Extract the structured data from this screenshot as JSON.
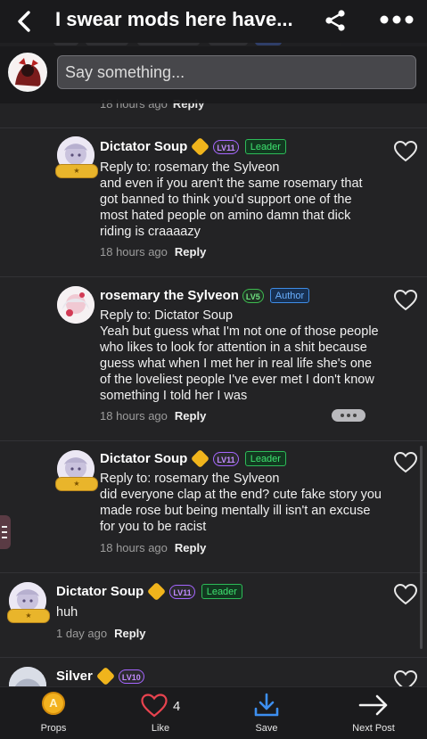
{
  "header": {
    "title": "I swear mods here have...",
    "back_icon": "chevron-left-icon",
    "share_icon": "share-icon",
    "more_icon": "more-horizontal-icon"
  },
  "composer": {
    "placeholder": "Say something..."
  },
  "previous_comment_meta": {
    "time": "18 hours ago",
    "reply": "Reply"
  },
  "comments": [
    {
      "username": "Dictator Soup",
      "level": "LV11",
      "tag": "Leader",
      "reply_to": "Reply to: rosemary the Sylveon",
      "text": "and even if you aren't the same rosemary that got banned to think you'd support one of the most hated people on amino damn that dick riding is craaaazy",
      "time": "18 hours ago",
      "reply": "Reply"
    },
    {
      "username": "rosemary the Sylveon",
      "level": "LV5",
      "tag": "Author",
      "reply_to": "Reply to: Dictator Soup",
      "text": "Yeah but guess what I'm not one of those people who likes to look for attention in a shit because guess what when I met her in real life she's one of the loveliest people I've ever met I don't know something I told her I was",
      "time": "18 hours ago",
      "reply": "Reply"
    },
    {
      "username": "Dictator Soup",
      "level": "LV11",
      "tag": "Leader",
      "reply_to": "Reply to: rosemary the Sylveon",
      "text": "did everyone clap at the end? cute fake story you made rose but being mentally ill isn't an excuse for you to be racist",
      "time": "18 hours ago",
      "reply": "Reply"
    },
    {
      "username": "Dictator Soup",
      "level": "LV11",
      "tag": "Leader",
      "text": "huh",
      "time": "1 day ago",
      "reply": "Reply"
    },
    {
      "username": "Silver",
      "level": "LV10"
    }
  ],
  "bottom_bar": {
    "props_label": "Props",
    "props_glyph": "A",
    "like_label": "Like",
    "like_count": "4",
    "save_label": "Save",
    "next_label": "Next Post"
  },
  "colors": {
    "background": "#232325",
    "leader_tag": "#3ee26f",
    "author_tag": "#6ab0ff",
    "like_heart": "#e8434f",
    "save_icon": "#3d8ff0"
  }
}
